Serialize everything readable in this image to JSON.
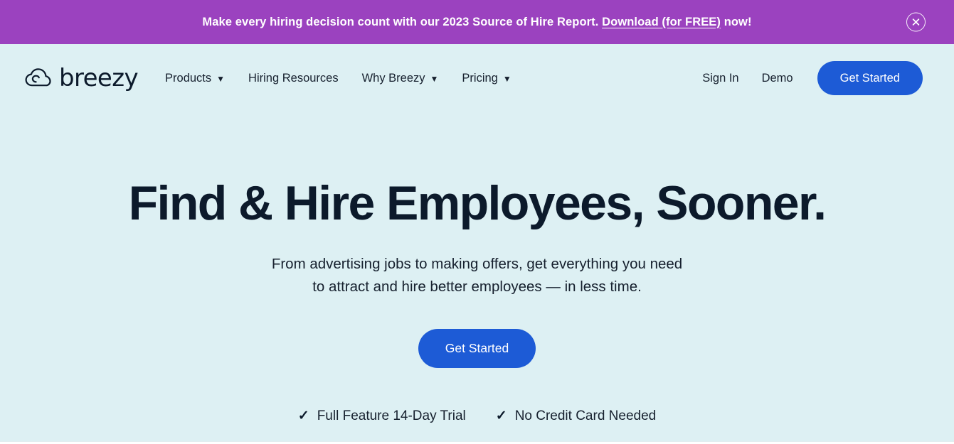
{
  "banner": {
    "text_before": "Make every hiring decision count with our 2023 Source of Hire Report.",
    "link_label": "Download (for FREE)",
    "text_after": "now!",
    "close_icon": "close-circle-icon",
    "background_color": "#9b42bf",
    "text_color": "#ffffff"
  },
  "nav": {
    "logo": {
      "icon": "cloud-icon",
      "text": "breezy"
    },
    "items": [
      {
        "label": "Products",
        "has_dropdown": true,
        "chevron": "chevron-down-icon"
      },
      {
        "label": "Hiring Resources",
        "has_dropdown": false,
        "chevron": ""
      },
      {
        "label": "Why Breezy",
        "has_dropdown": true,
        "chevron": "chevron-down-icon"
      },
      {
        "label": "Pricing",
        "has_dropdown": true,
        "chevron": "chevron-down-icon"
      }
    ],
    "sign_in_label": "Sign In",
    "demo_label": "Demo",
    "cta_label": "Get Started",
    "cta_color": "#1d5bd6"
  },
  "hero": {
    "title": "Find & Hire Employees, Sooner.",
    "subtitle_line1": "From advertising jobs to making offers, get everything you need",
    "subtitle_line2": "to attract and hire better employees — in less time.",
    "cta_label": "Get Started",
    "trust": [
      {
        "check_icon": "check-icon",
        "label": "Full Feature 14-Day Trial"
      },
      {
        "check_icon": "check-icon",
        "label": "No Credit Card Needed"
      }
    ]
  },
  "theme": {
    "page_background": "#ddf0f3",
    "heading_color": "#0c1a2b",
    "accent_blue": "#1d5bd6",
    "accent_purple": "#9b42bf"
  }
}
